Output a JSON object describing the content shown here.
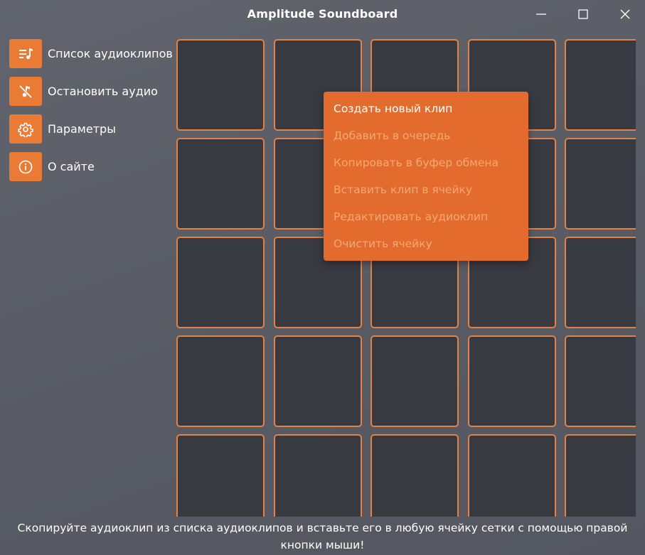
{
  "window": {
    "title": "Amplitude Soundboard",
    "controls": [
      "minimize-icon",
      "maximize-icon",
      "close-icon"
    ]
  },
  "sidebar": {
    "items": [
      {
        "label": "Список аудиоклипов",
        "icon": "playlist-icon"
      },
      {
        "label": "Остановить аудио",
        "icon": "music-off-icon"
      },
      {
        "label": "Параметры",
        "icon": "gear-icon"
      },
      {
        "label": "О сайте",
        "icon": "info-icon"
      }
    ]
  },
  "grid": {
    "rows_visible": 5,
    "columns_visible": 5
  },
  "context_menu": {
    "items": [
      {
        "label": "Создать новый клип",
        "enabled": true
      },
      {
        "label": "Добавить в очередь",
        "enabled": false
      },
      {
        "label": "Копировать в буфер обмена",
        "enabled": false
      },
      {
        "label": "Вставить клип в ячейку",
        "enabled": false
      },
      {
        "label": "Редактировать аудиоклип",
        "enabled": false
      },
      {
        "label": "Очистить ячейку",
        "enabled": false
      }
    ]
  },
  "status_bar": {
    "line1": "Скопируйте аудиоклип из списка аудиоклипов и вставьте его в любую ячейку сетки с помощью правой",
    "line2": "кнопки мыши!"
  },
  "colors": {
    "accent": "#ea7b35",
    "menu_background": "#e26b2d",
    "cell_background": "#383a41",
    "cell_border": "#e48144",
    "window_background": "#5b5e68"
  }
}
